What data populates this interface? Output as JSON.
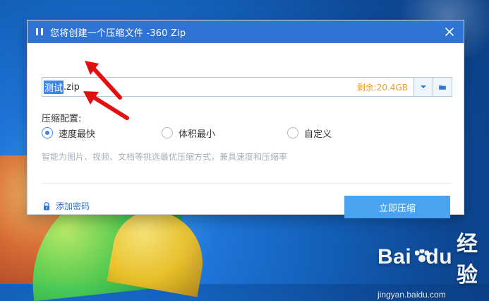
{
  "window": {
    "title": "您将创建一个压缩文件 -360 Zip"
  },
  "file": {
    "selected_part": "测试",
    "rest_part": ".zip",
    "free_space": "剩余:20.4GB"
  },
  "compression": {
    "label": "压缩配置:",
    "options": [
      {
        "label": "速度最快",
        "checked": true
      },
      {
        "label": "体积最小",
        "checked": false
      },
      {
        "label": "自定义",
        "checked": false
      }
    ],
    "hint": "智能为图片、视频、文档等挑选最优压缩方式，兼具速度和压缩率"
  },
  "actions": {
    "add_password": "添加密码",
    "compress_now": "立即压缩"
  },
  "watermark": {
    "line1_part1": "Bai",
    "line1_part2": "du",
    "line1_part3": "经验",
    "line2": "jingyan.baidu.com"
  },
  "icons": {
    "app": "zip-icon",
    "close": "close-icon",
    "dropdown": "chevron-down-icon",
    "folder": "folder-icon",
    "lock": "lock-icon"
  },
  "colors": {
    "titlebar": "#2f73d4",
    "primary_button": "#4aa3f1",
    "free_space": "#f29b21",
    "selection": "#3e86e6"
  }
}
